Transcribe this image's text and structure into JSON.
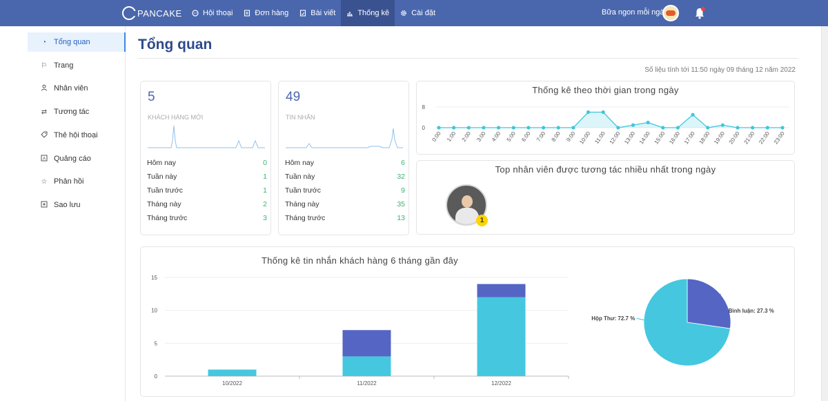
{
  "topbar": {
    "brand": "PANCAKE",
    "nav": [
      {
        "label": "Hội thoại",
        "icon": "chat-icon"
      },
      {
        "label": "Đơn hàng",
        "icon": "order-icon"
      },
      {
        "label": "Bài viết",
        "icon": "post-icon"
      },
      {
        "label": "Thống kê",
        "icon": "chart-icon",
        "active": true
      },
      {
        "label": "Cài đặt",
        "icon": "settings-icon"
      }
    ],
    "page_name": "Bữa ngon mỗi ngày"
  },
  "sidebar": {
    "items": [
      {
        "label": "Tổng quan",
        "icon": "dashboard-icon",
        "active": true
      },
      {
        "label": "Trang",
        "icon": "flag-icon"
      },
      {
        "label": "Nhân viên",
        "icon": "user-icon"
      },
      {
        "label": "Tương tác",
        "icon": "swap-icon"
      },
      {
        "label": "Thẻ hội thoại",
        "icon": "tag-icon"
      },
      {
        "label": "Quảng cáo",
        "icon": "ad-icon"
      },
      {
        "label": "Phản hồi",
        "icon": "star-icon"
      },
      {
        "label": "Sao lưu",
        "icon": "backup-icon"
      }
    ]
  },
  "main": {
    "title": "Tổng quan",
    "as_of": "Số liệu tính tới 11:50 ngày 09 tháng 12 năm 2022"
  },
  "cards": {
    "customers": {
      "number": "5",
      "label": "KHÁCH HÀNG MỚI",
      "rows": [
        {
          "label": "Hôm nay",
          "value": "0"
        },
        {
          "label": "Tuần này",
          "value": "1"
        },
        {
          "label": "Tuần trước",
          "value": "1"
        },
        {
          "label": "Tháng này",
          "value": "2"
        },
        {
          "label": "Tháng trước",
          "value": "3"
        }
      ]
    },
    "messages": {
      "number": "49",
      "label": "TIN NHẮN",
      "rows": [
        {
          "label": "Hôm nay",
          "value": "6"
        },
        {
          "label": "Tuần này",
          "value": "32"
        },
        {
          "label": "Tuần trước",
          "value": "9"
        },
        {
          "label": "Tháng này",
          "value": "35"
        },
        {
          "label": "Tháng trước",
          "value": "13"
        }
      ]
    },
    "top_staff": {
      "title": "Top nhân viên được tương tác nhiều nhất trong ngày",
      "rank": "1"
    }
  },
  "chart_data": [
    {
      "type": "line",
      "title": "Thống kê theo thời gian trong ngày",
      "x": [
        "0:00",
        "1:00",
        "2:00",
        "3:00",
        "4:00",
        "5:00",
        "6:00",
        "7:00",
        "8:00",
        "9:00",
        "10:00",
        "11:00",
        "12:00",
        "13:00",
        "14:00",
        "15:00",
        "16:00",
        "17:00",
        "18:00",
        "19:00",
        "20:00",
        "21:00",
        "22:00",
        "23:00"
      ],
      "values": [
        0,
        0,
        0,
        0,
        0,
        0,
        0,
        0,
        0,
        0,
        6,
        6,
        0,
        1,
        2,
        0,
        0,
        5,
        0,
        1,
        0,
        0,
        0,
        0
      ],
      "yticks": [
        "0",
        "8"
      ],
      "ylim": [
        0,
        8
      ],
      "grid": true,
      "color": "#3fc6dc"
    },
    {
      "type": "bar",
      "title": "Thống kê tin nhắn khách hàng 6 tháng gần đây",
      "categories": [
        "10/2022",
        "11/2022",
        "12/2022"
      ],
      "series": [
        {
          "values": [
            1,
            3,
            12
          ],
          "color": "#45c8df"
        },
        {
          "values": [
            0,
            4,
            2
          ],
          "color": "#5565c4"
        }
      ],
      "yticks": [
        "0",
        "5",
        "10",
        "15"
      ],
      "ylim": [
        0,
        15
      ],
      "grid": true
    },
    {
      "type": "pie",
      "slices": [
        {
          "label": "Bình luận: 27.3 %",
          "value": 27.3,
          "color": "#5565c4"
        },
        {
          "label": "Hộp Thư: 72.7 %",
          "value": 72.7,
          "color": "#45c8df"
        }
      ]
    }
  ]
}
